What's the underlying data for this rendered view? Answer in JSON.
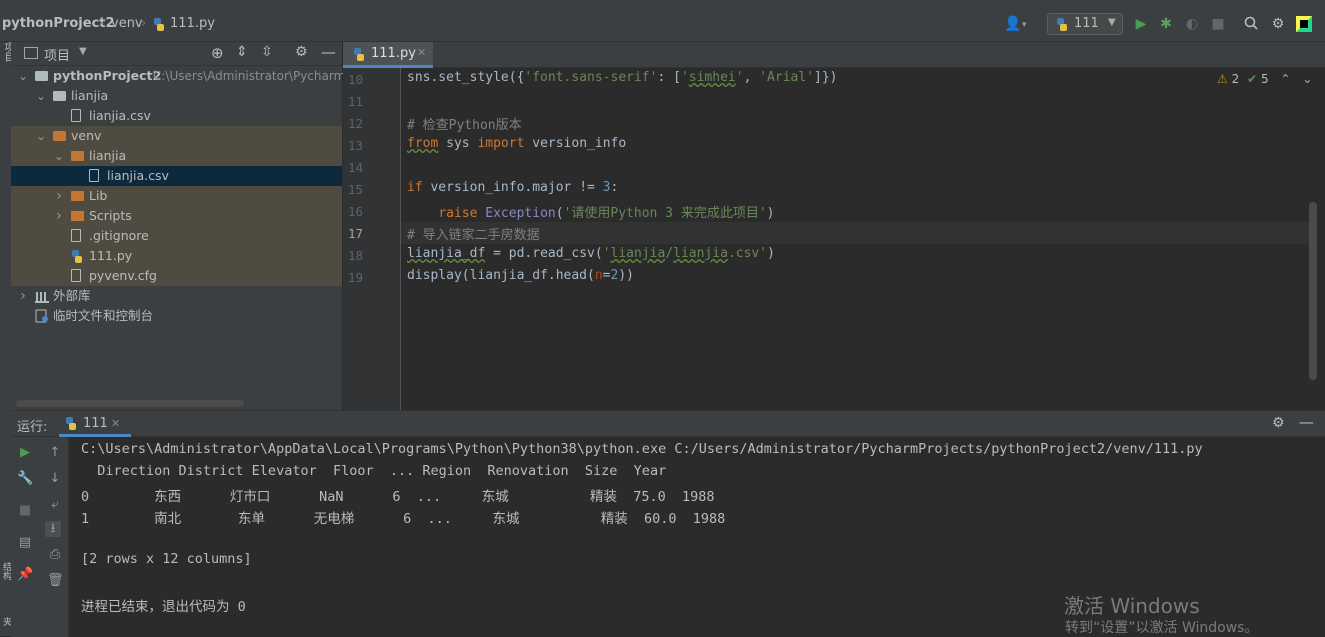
{
  "navbar": {
    "project": "pythonProject2",
    "folder": "venv",
    "file": "111.py",
    "run_config": "111"
  },
  "project_panel": {
    "title": "项目",
    "tree": [
      {
        "label": "pythonProject2",
        "path": "C:\\Users\\Administrator\\Pycharm",
        "type": "folder",
        "depth": 0,
        "expanded": true
      },
      {
        "label": "lianjia",
        "type": "folder",
        "depth": 1,
        "expanded": true
      },
      {
        "label": "lianjia.csv",
        "type": "file",
        "depth": 2
      },
      {
        "label": "venv",
        "type": "folder-orange",
        "depth": 1,
        "expanded": true
      },
      {
        "label": "lianjia",
        "type": "folder-orange",
        "depth": 2,
        "expanded": true
      },
      {
        "label": "lianjia.csv",
        "type": "file",
        "depth": 3,
        "selected": true
      },
      {
        "label": "Lib",
        "type": "folder-orange",
        "depth": 2,
        "expanded": false
      },
      {
        "label": "Scripts",
        "type": "folder-orange",
        "depth": 2,
        "expanded": false
      },
      {
        "label": ".gitignore",
        "type": "file",
        "depth": 2
      },
      {
        "label": "111.py",
        "type": "python",
        "depth": 2
      },
      {
        "label": "pyvenv.cfg",
        "type": "file",
        "depth": 2
      },
      {
        "label": "外部库",
        "type": "library",
        "depth": 0,
        "expanded": false
      },
      {
        "label": "临时文件和控制台",
        "type": "scratch",
        "depth": 0
      }
    ]
  },
  "editor": {
    "tab_label": "111.py",
    "inspections": {
      "warnings": "2",
      "ok": "5"
    },
    "line_numbers": [
      "10",
      "11",
      "12",
      "13",
      "14",
      "15",
      "16",
      "17",
      "18",
      "19"
    ]
  },
  "run_panel": {
    "label": "运行:",
    "tab": "111",
    "output": [
      "C:\\Users\\Administrator\\AppData\\Local\\Programs\\Python\\Python38\\python.exe C:/Users/Administrator/PycharmProjects/pythonProject2/venv/111.py",
      "  Direction District Elevator  Floor  ... Region  Renovation  Size  Year",
      "0        东西      灯市口      NaN      6  ...     东城          精装  75.0  1988",
      "1        南北       东单      无电梯      6  ...     东城          精装  60.0  1988",
      "",
      "[2 rows x 12 columns]",
      "",
      "进程已结束，退出代码为 0"
    ]
  },
  "watermark": {
    "line1": "激活 Windows",
    "line2": "转到“设置”以激活 Windows。"
  },
  "colors": {
    "keyword": "#cc7832",
    "string": "#6a8759",
    "number": "#6897bb",
    "comment": "#808080",
    "run_green": "#499c54",
    "selection": "#0d293e",
    "venv_bg": "#4f4b41"
  }
}
